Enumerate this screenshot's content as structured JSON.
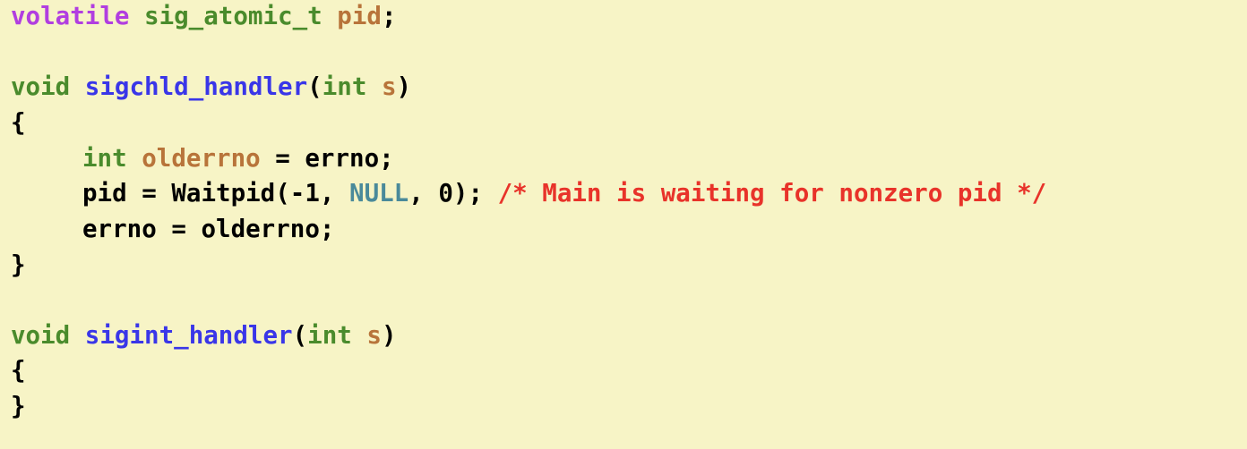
{
  "colors": {
    "background": "#f7f4c6",
    "keyword": "#b13ee0",
    "type": "#4a8b2c",
    "function": "#3a36e8",
    "variable": "#b8743a",
    "constant": "#4a8a9a",
    "comment": "#e8332a",
    "plain": "#000000"
  },
  "code": {
    "l1": {
      "t1": "volatile",
      "t2": "sig_atomic_t",
      "t3": "pid",
      "t4": ";"
    },
    "l3": {
      "t1": "void",
      "t2": "sigchld_handler",
      "t3": "(",
      "t4": "int",
      "t5": "s",
      "t6": ")"
    },
    "l4": {
      "t1": "{"
    },
    "l5": {
      "t1": "int",
      "t2": "olderrno",
      "t3": " = errno;"
    },
    "l6": {
      "t1": "pid = Waitpid(-1, ",
      "t2": "NULL",
      "t3": ", 0); ",
      "t4": "/* Main is waiting for nonzero pid */"
    },
    "l7": {
      "t1": "errno = olderrno;"
    },
    "l8": {
      "t1": "}"
    },
    "l10": {
      "t1": "void",
      "t2": "sigint_handler",
      "t3": "(",
      "t4": "int",
      "t5": "s",
      "t6": ")"
    },
    "l11": {
      "t1": "{"
    },
    "l12": {
      "t1": "}"
    }
  }
}
